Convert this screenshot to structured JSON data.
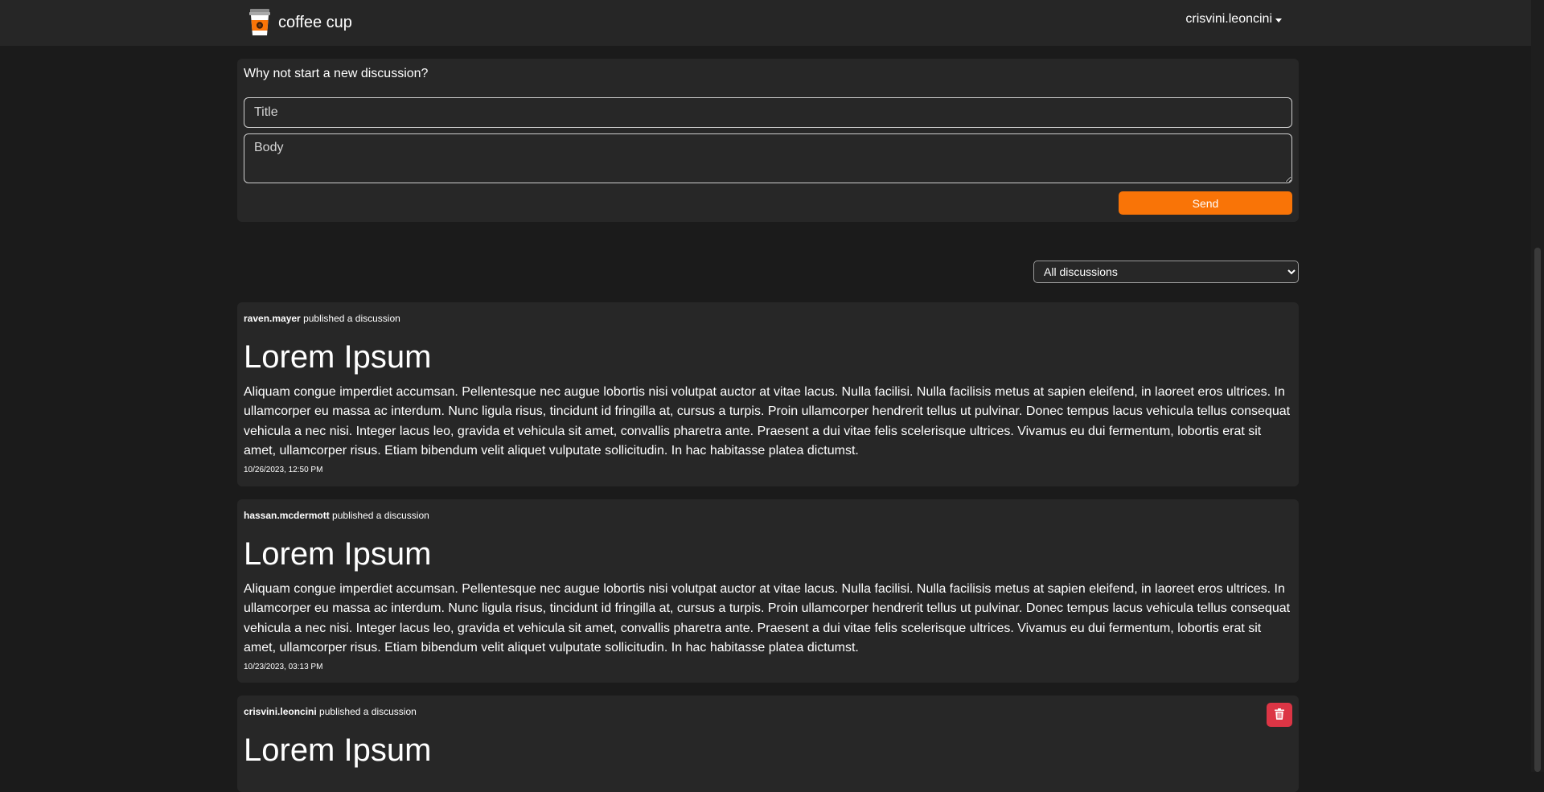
{
  "header": {
    "brand_name": "coffee cup",
    "brand_icon": "coffee-cup-icon",
    "user_name": "crisvini.leoncini"
  },
  "new_discussion": {
    "heading": "Why not start a new discussion?",
    "title_placeholder": "Title",
    "title_value": "",
    "body_placeholder": "Body",
    "body_value": "",
    "send_label": "Send"
  },
  "filter": {
    "selected": "All discussions"
  },
  "posts": [
    {
      "author": "raven.mayer",
      "action": "published a discussion",
      "title": "Lorem Ipsum",
      "body": "Aliquam congue imperdiet accumsan. Pellentesque nec augue lobortis nisi volutpat auctor at vitae lacus. Nulla facilisi. Nulla facilisis metus at sapien eleifend, in laoreet eros ultrices. In ullamcorper eu massa ac interdum. Nunc ligula risus, tincidunt id fringilla at, cursus a turpis. Proin ullamcorper hendrerit tellus ut pulvinar. Donec tempus lacus vehicula tellus consequat vehicula a nec nisi. Integer lacus leo, gravida et vehicula sit amet, convallis pharetra ante. Praesent a dui vitae felis scelerisque ultrices. Vivamus eu dui fermentum, lobortis erat sit amet, ullamcorper risus. Etiam bibendum velit aliquet vulputate sollicitudin. In hac habitasse platea dictumst.",
      "date": "10/26/2023, 12:50 PM"
    },
    {
      "author": "hassan.mcdermott",
      "action": "published a discussion",
      "title": "Lorem Ipsum",
      "body": "Aliquam congue imperdiet accumsan. Pellentesque nec augue lobortis nisi volutpat auctor at vitae lacus. Nulla facilisi. Nulla facilisis metus at sapien eleifend, in laoreet eros ultrices. In ullamcorper eu massa ac interdum. Nunc ligula risus, tincidunt id fringilla at, cursus a turpis. Proin ullamcorper hendrerit tellus ut pulvinar. Donec tempus lacus vehicula tellus consequat vehicula a nec nisi. Integer lacus leo, gravida et vehicula sit amet, convallis pharetra ante. Praesent a dui vitae felis scelerisque ultrices. Vivamus eu dui fermentum, lobortis erat sit amet, ullamcorper risus. Etiam bibendum velit aliquet vulputate sollicitudin. In hac habitasse platea dictumst.",
      "date": "10/23/2023, 03:13 PM"
    },
    {
      "author": "crisvini.leoncini",
      "action": "published a discussion",
      "title": "Lorem Ipsum",
      "delete_icon": "trash-icon"
    }
  ],
  "colors": {
    "accent": "#f97407",
    "danger": "#dc3545",
    "background": "#1b1b1b",
    "card": "#272727"
  }
}
